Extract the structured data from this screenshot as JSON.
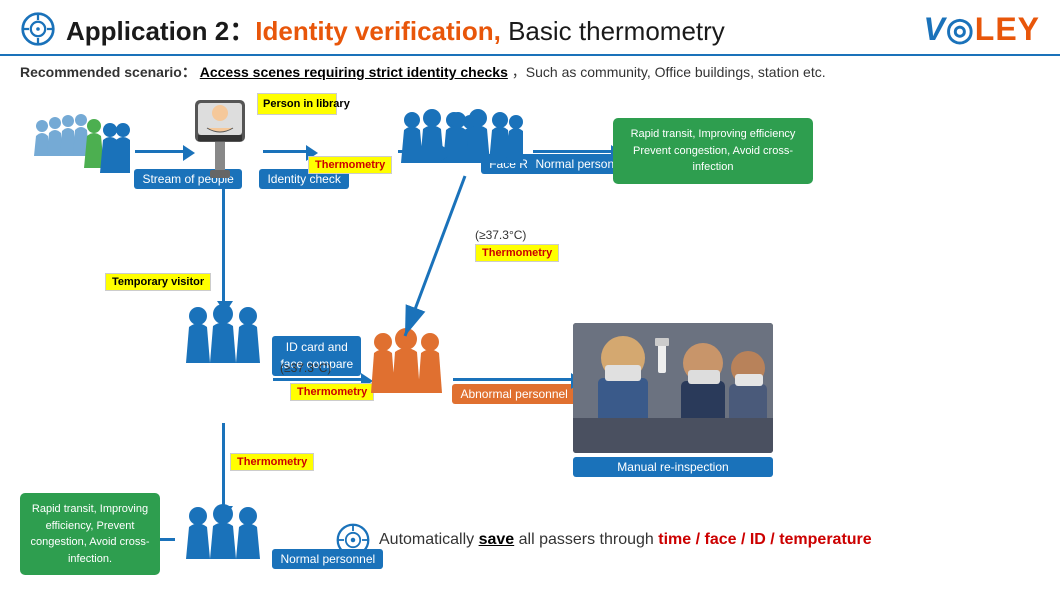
{
  "header": {
    "app_label": "Application 2：",
    "title_highlight": "Identity verification,",
    "title_rest": " Basic thermometry",
    "logo": "VCLEY"
  },
  "recommended": {
    "label": "Recommended scenario：",
    "scenario": "Access scenes requiring strict identity checks",
    "rest": "，Such as community, Office buildings, station etc."
  },
  "flow": {
    "stream_label": "Stream of people",
    "identity_label": "Identity check",
    "face_label": "Face Recognition",
    "normal_label": "Normal personnel",
    "id_card_label": "ID card and\nface compare",
    "abnormal_label": "Abnormal\npersonnel",
    "manual_label": "Manual re-inspection",
    "normal2_label": "Normal personnel",
    "person_in_library": "Person in\nlibrary",
    "thermometry1": "Thermometry",
    "thermometry2": "Thermometry",
    "thermometry3": "Thermometry",
    "temp_visitor": "Temporary visitor",
    "temp_threshold1": "(≥37.3°C)",
    "temp_threshold2": "(≥37.3°C)\nThermometry",
    "rapid_transit_top": "Rapid transit, Improving efficiency\nPrevent congestion, Avoid cross-infection",
    "rapid_transit_bottom": "Rapid transit,\nImproving efficiency,\nPrevent congestion,\nAvoid cross-infection.",
    "auto_save_text": "Automatically ",
    "auto_save_save": "save",
    "auto_save_rest": " all passers through ",
    "auto_save_items": "time / face / ID / temperature"
  }
}
